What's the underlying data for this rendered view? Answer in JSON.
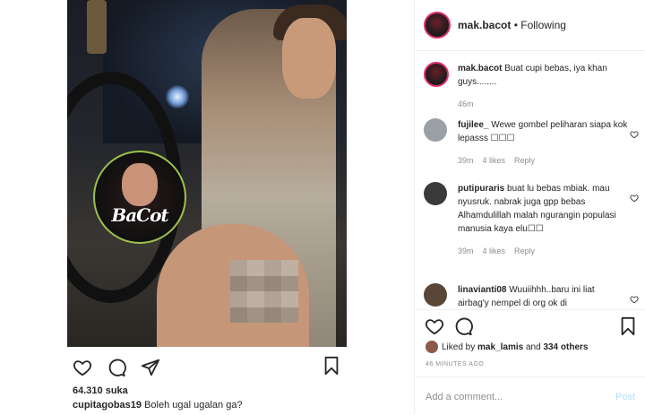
{
  "post": {
    "likes_count": "64.310 suka",
    "caption_user": "cupitagobas19",
    "caption_text": " Boleh ugal ugalan ga?",
    "watermark_text": "BaCot"
  },
  "header": {
    "username": "mak.bacot",
    "separator": " • ",
    "follow_status": "Following"
  },
  "comments": [
    {
      "user": "mak.bacot",
      "text": " Buat cupi bebas, iya khan guys........",
      "time": "46m",
      "likes": "",
      "reply": ""
    },
    {
      "user": "fujilee_",
      "text": " Wewe gombel peliharan siapa kok lepasss ☐☐☐",
      "time": "39m",
      "likes": "4 likes",
      "reply": "Reply"
    },
    {
      "user": "putipuraris",
      "text": " buat lu bebas mbiak. mau nyusruk. nabrak juga gpp bebas Alhamdulillah malah ngurangin populasi manusia kaya elu☐☐",
      "time": "39m",
      "likes": "4 likes",
      "reply": "Reply"
    },
    {
      "user": "linavianti08",
      "text": " Wuuiihhh..baru ini liat airbag'y nempel di org ok di",
      "time": "",
      "likes": "",
      "reply": ""
    }
  ],
  "actions": {
    "liked_by_prefix": "Liked by ",
    "liked_by_user": "mak_lamis",
    "liked_by_suffix": " and ",
    "others": "334 others",
    "timestamp": "46 MINUTES AGO"
  },
  "comment_box": {
    "placeholder": "Add a comment...",
    "post_label": "Post"
  },
  "icons": [
    "heart-icon",
    "comment-icon",
    "share-icon",
    "bookmark-icon"
  ]
}
